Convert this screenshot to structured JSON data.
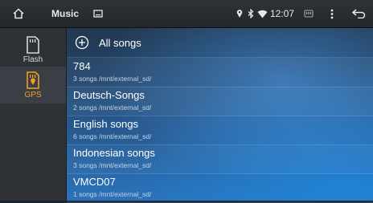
{
  "statusbar": {
    "app_title": "Music",
    "time": "12:07"
  },
  "sidebar": {
    "items": [
      {
        "label": "Flash",
        "icon": "sd-card-icon"
      },
      {
        "label": "GPS",
        "icon": "sd-card-gps-icon",
        "selected": true
      }
    ]
  },
  "main": {
    "all_songs_label": "All songs",
    "folders": [
      {
        "name": "784",
        "info": "3 songs /mnt/external_sd/"
      },
      {
        "name": "Deutsch-Songs",
        "info": "2 songs /mnt/external_sd/"
      },
      {
        "name": "English songs",
        "info": "6 songs /mnt/external_sd/"
      },
      {
        "name": "Indonesian songs",
        "info": "3 songs /mnt/external_sd/"
      },
      {
        "name": "VMCD07",
        "info": "1 songs /mnt/external_sd/"
      }
    ]
  },
  "colors": {
    "accent": "#f0a020",
    "sidebar_bg": "#2e3237",
    "statusbar_bg": "#2a2e32"
  }
}
